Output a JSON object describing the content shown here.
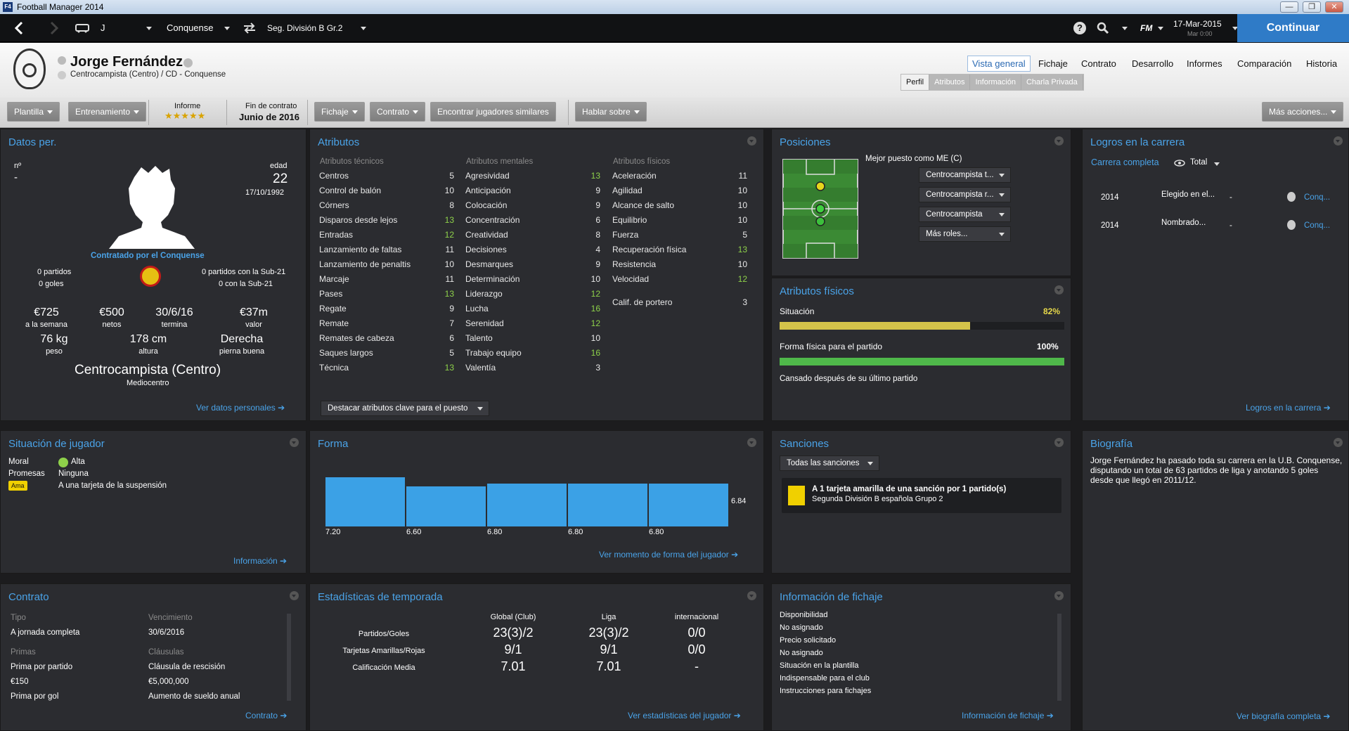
{
  "window": {
    "title": "Football Manager 2014",
    "logo": "F4",
    "min": "—",
    "max": "❐",
    "close": "✕"
  },
  "topnav": {
    "player_short": "J",
    "club": "Conquense",
    "competition": "Seg. División B Gr.2",
    "date": "17-Mar-2015",
    "time": "Mar 0:00",
    "fm": "FM",
    "continue": "Continuar"
  },
  "player": {
    "name": "Jorge Fernández",
    "subtitle": "Centrocampista (Centro) / CD - Conquense"
  },
  "header_tabs": [
    "Vista general",
    "Fichaje",
    "Contrato",
    "Desarrollo",
    "Informes",
    "Comparación",
    "Historia"
  ],
  "sub_tabs": [
    "Perfil",
    "Atributos",
    "Información",
    "Charla Privada"
  ],
  "actions": {
    "plantilla": "Plantilla",
    "entrenamiento": "Entrenamiento",
    "informe": "Informe",
    "stars": "★★★★★",
    "fin_label": "Fin de contrato",
    "fin_value": "Junio de 2016",
    "fichaje": "Fichaje",
    "contrato": "Contrato",
    "similares": "Encontrar jugadores similares",
    "hablar": "Hablar sobre",
    "mas": "Más acciones..."
  },
  "datos": {
    "title": "Datos per.",
    "num_label": "nº",
    "num_value": "-",
    "edad_label": "edad",
    "edad_value": "22",
    "dob": "17/10/1992",
    "contratado": "Contratado por el Conquense",
    "partidos": "0 partidos",
    "goles": "0 goles",
    "sub21_partidos": "0 partidos con la Sub-21",
    "sub21_goles": "0 con la Sub-21",
    "stats": [
      {
        "v": "€725",
        "l": "a la semana"
      },
      {
        "v": "€500",
        "l": "netos"
      },
      {
        "v": "30/6/16",
        "l": "termina"
      },
      {
        "v": "€37m",
        "l": "valor"
      }
    ],
    "stats2": [
      {
        "v": "76 kg",
        "l": "peso"
      },
      {
        "v": "178 cm",
        "l": "altura"
      },
      {
        "v": "Derecha",
        "l": "pierna buena"
      }
    ],
    "position": "Centrocampista (Centro)",
    "role": "Mediocentro",
    "link": "Ver datos personales ➔"
  },
  "atributos": {
    "title": "Atributos",
    "tec_title": "Atributos técnicos",
    "men_title": "Atributos mentales",
    "fis_title": "Atributos físicos",
    "tec": [
      [
        "Centros",
        "5"
      ],
      [
        "Control de balón",
        "10"
      ],
      [
        "Córners",
        "8"
      ],
      [
        "Disparos desde lejos",
        "13"
      ],
      [
        "Entradas",
        "12"
      ],
      [
        "Lanzamiento de faltas",
        "11"
      ],
      [
        "Lanzamiento de penaltis",
        "10"
      ],
      [
        "Marcaje",
        "11"
      ],
      [
        "Pases",
        "13"
      ],
      [
        "Regate",
        "9"
      ],
      [
        "Remate",
        "7"
      ],
      [
        "Remates de cabeza",
        "6"
      ],
      [
        "Saques largos",
        "5"
      ],
      [
        "Técnica",
        "13"
      ]
    ],
    "men": [
      [
        "Agresividad",
        "13"
      ],
      [
        "Anticipación",
        "9"
      ],
      [
        "Colocación",
        "9"
      ],
      [
        "Concentración",
        "6"
      ],
      [
        "Creatividad",
        "8"
      ],
      [
        "Decisiones",
        "4"
      ],
      [
        "Desmarques",
        "9"
      ],
      [
        "Determinación",
        "10"
      ],
      [
        "Liderazgo",
        "12"
      ],
      [
        "Lucha",
        "16"
      ],
      [
        "Serenidad",
        "12"
      ],
      [
        "Talento",
        "10"
      ],
      [
        "Trabajo equipo",
        "16"
      ],
      [
        "Valentía",
        "3"
      ]
    ],
    "fis": [
      [
        "Aceleración",
        "11"
      ],
      [
        "Agilidad",
        "10"
      ],
      [
        "Alcance de salto",
        "10"
      ],
      [
        "Equilibrio",
        "10"
      ],
      [
        "Fuerza",
        "5"
      ],
      [
        "Recuperación física",
        "13"
      ],
      [
        "Resistencia",
        "10"
      ],
      [
        "Velocidad",
        "12"
      ]
    ],
    "portero_label": "Calif. de portero",
    "portero_value": "3",
    "destacar": "Destacar atributos clave para el puesto"
  },
  "posiciones": {
    "title": "Posiciones",
    "best": "Mejor puesto como ME (C)",
    "roles": [
      "Centrocampista t...",
      "Centrocampista r...",
      "Centrocampista",
      "Más roles..."
    ]
  },
  "fisicos": {
    "title": "Atributos físicos",
    "situacion": "Situación",
    "situacion_pct": "82%",
    "situacion_val": 0.82,
    "forma": "Forma física para el partido",
    "forma_pct": "100%",
    "forma_val": 1.0,
    "cansado": "Cansado después de su último partido",
    "colors": {
      "situacion": "#d4c34a",
      "forma": "#4fb84a"
    }
  },
  "logros": {
    "title": "Logros en la carrera",
    "carrera": "Carrera completa",
    "total": "Total",
    "rows": [
      [
        "2014",
        "Elegido en el...",
        "-",
        "Conq..."
      ],
      [
        "2014",
        "Nombrado...",
        "-",
        "Conq..."
      ]
    ],
    "link": "Logros en la carrera ➔"
  },
  "situacion": {
    "title": "Situación de jugador",
    "moral_l": "Moral",
    "moral_v": "Alta",
    "promesas_l": "Promesas",
    "promesas_v": "Ninguna",
    "ama": "Ama",
    "ama_text": "A una tarjeta de la suspensión",
    "link": "Información ➔"
  },
  "forma": {
    "title": "Forma",
    "avg": "6.84",
    "bars": [
      {
        "v": 7.2,
        "l": "7.20"
      },
      {
        "v": 6.6,
        "l": "6.60"
      },
      {
        "v": 6.8,
        "l": "6.80"
      },
      {
        "v": 6.8,
        "l": "6.80"
      },
      {
        "v": 6.8,
        "l": "6.80"
      }
    ],
    "link": "Ver momento de forma del jugador ➔"
  },
  "sanciones": {
    "title": "Sanciones",
    "filter": "Todas las sanciones",
    "text": "A 1 tarjeta amarilla de una sanción por 1 partido(s)",
    "comp": "Segunda División B española Grupo 2"
  },
  "biografia": {
    "title": "Biografía",
    "text": "Jorge Fernández ha pasado toda su carrera en la U.B. Conquense, disputando un total de 63 partidos de liga y anotando 5 goles desde que llegó en 2011/12.",
    "link": "Ver biografía completa ➔"
  },
  "contrato": {
    "title": "Contrato",
    "tipo_l": "Tipo",
    "venc_l": "Vencimiento",
    "tipo": "A jornada completa",
    "venc": "30/6/2016",
    "primas_l": "Primas",
    "clausulas_l": "Cláusulas",
    "pp_l": "Prima por partido",
    "pp": "€150",
    "cr_l": "Cláusula de rescisión",
    "cr": "€5,000,000",
    "pg_l": "Prima por gol",
    "aumento": "Aumento de sueldo anual",
    "link": "Contrato ➔"
  },
  "estadisticas": {
    "title": "Estadísticas de temporada",
    "cols": [
      "Global (Club)",
      "Liga",
      "internacional"
    ],
    "rows": [
      [
        "Partidos/Goles",
        "23(3)/2",
        "23(3)/2",
        "0/0"
      ],
      [
        "Tarjetas Amarillas/Rojas",
        "9/1",
        "9/1",
        "0/0"
      ],
      [
        "Calificación Media",
        "7.01",
        "7.01",
        "-"
      ]
    ],
    "link": "Ver estadísticas del jugador ➔"
  },
  "fichaje": {
    "title": "Información de fichaje",
    "items": [
      [
        "Disponibilidad",
        "No asignado"
      ],
      [
        "Precio solicitado",
        "No asignado"
      ],
      [
        "Situación en la plantilla",
        "Indispensable para el club"
      ],
      [
        "Instrucciones para fichajes",
        ""
      ]
    ],
    "link": "Información de fichaje ➔"
  }
}
